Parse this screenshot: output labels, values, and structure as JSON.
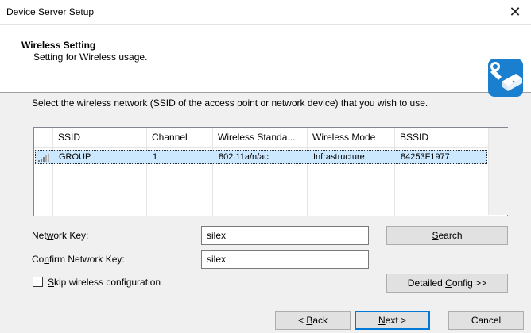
{
  "window": {
    "title": "Device Server Setup",
    "close_glyph": "✕"
  },
  "header": {
    "title": "Wireless Setting",
    "subtitle": "Setting for Wireless usage.",
    "icon": "wrench-router-icon"
  },
  "instruction": "Select the wireless network (SSID of the access point or network device) that you wish to use.",
  "network_list": {
    "columns": [
      "SSID",
      "Channel",
      "Wireless Standa...",
      "Wireless Mode",
      "BSSID"
    ],
    "rows": [
      {
        "ssid": "GROUP",
        "channel": "1",
        "standard": "802.11a/n/ac",
        "mode": "Infrastructure",
        "bssid": "84253F1977",
        "selected": true
      }
    ]
  },
  "form": {
    "network_key": {
      "label_pre": "Net",
      "label_ul": "w",
      "label_post": "ork Key:",
      "value": "silex"
    },
    "confirm_key": {
      "label_pre": "Co",
      "label_ul": "n",
      "label_post": "firm Network Key:",
      "value": "silex"
    },
    "skip": {
      "label_pre": "",
      "label_ul": "S",
      "label_post": "kip wireless configuration",
      "checked": false
    }
  },
  "buttons": {
    "search": {
      "pre": "",
      "ul": "S",
      "post": "earch"
    },
    "detailed": {
      "pre": "Detailed ",
      "ul": "C",
      "post": "onfig >>"
    },
    "back": {
      "pre": "< ",
      "ul": "B",
      "post": "ack"
    },
    "next": {
      "pre": "",
      "ul": "N",
      "post": "ext >"
    },
    "cancel": {
      "pre": "",
      "ul": "",
      "post": "Cancel"
    }
  },
  "colors": {
    "accent": "#0078d7",
    "selection": "#cce8ff",
    "icon_blue": "#1b7fcf"
  }
}
